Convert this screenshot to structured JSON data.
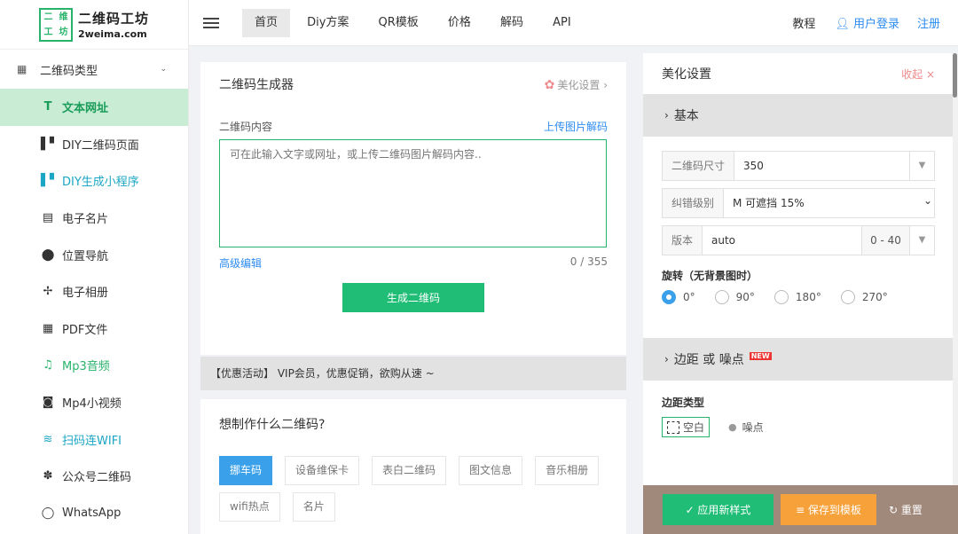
{
  "logo": {
    "mark": [
      "二",
      "维",
      "工",
      "坊"
    ],
    "name_cn": "二维码工坊",
    "name_en": "2weima.com"
  },
  "sidebar": {
    "group_label": "二维码类型",
    "items": [
      {
        "label": "文本网址",
        "icon": "T"
      },
      {
        "label": "DIY二维码页面",
        "icon": "▌▘"
      },
      {
        "label": "DIY生成小程序",
        "icon": "▌▘"
      },
      {
        "label": "电子名片",
        "icon": "▤"
      },
      {
        "label": "位置导航",
        "icon": "⬤"
      },
      {
        "label": "电子相册",
        "icon": "✢"
      },
      {
        "label": "PDF文件",
        "icon": "▦"
      },
      {
        "label": "Mp3音频",
        "icon": "♫"
      },
      {
        "label": "Mp4小视频",
        "icon": "◙"
      },
      {
        "label": "扫码连WIFI",
        "icon": "≋"
      },
      {
        "label": "公众号二维码",
        "icon": "✽"
      },
      {
        "label": "WhatsApp",
        "icon": "◯"
      }
    ]
  },
  "nav": {
    "items": [
      "首页",
      "Diy方案",
      "QR模板",
      "价格",
      "解码",
      "API"
    ]
  },
  "topright": {
    "tutorial": "教程",
    "login": "用户登录",
    "register": "注册"
  },
  "generator": {
    "title": "二维码生成器",
    "beautify_link": "美化设置 ›",
    "content_label": "二维码内容",
    "upload_decode": "上传图片解码",
    "placeholder": "可在此输入文字或网址，或上传二维码图片解码内容..",
    "advanced_edit": "高级编辑",
    "char_count": "0 / 355",
    "generate_button": "生成二维码"
  },
  "promo": {
    "text": "【优惠活动】 VIP会员，优惠促销，欲购从速 ~"
  },
  "make": {
    "title": "想制作什么二维码?",
    "tags": [
      "挪车码",
      "设备维保卡",
      "表白二维码",
      "图文信息",
      "音乐相册",
      "wifi热点",
      "名片"
    ]
  },
  "panel": {
    "title": "美化设置",
    "collapse": "收起 ×",
    "basic_section": "基本",
    "size_label": "二维码尺寸",
    "size_value": "350",
    "ecc_label": "纠错级别",
    "ecc_value": "M 可遮挡 15%",
    "version_label": "版本",
    "version_value": "auto",
    "version_range": "0 - 40",
    "rotate_title": "旋转（无背景图时）",
    "rotations": [
      "0°",
      "90°",
      "180°",
      "270°"
    ],
    "margin_section": "边距 或 噪点",
    "new_badge": "NEW",
    "margin_type_title": "边距类型",
    "margin_blank": "空白",
    "margin_noise": "噪点"
  },
  "actions": {
    "apply": "✓ 应用新样式",
    "save": "≡ 保存到模板",
    "reset": "↻ 重置"
  },
  "colors": {
    "primary_green": "#1fbd75",
    "link_blue": "#2d8cf0",
    "tag_blue": "#3aa0ea",
    "save_orange": "#f7a13a"
  }
}
